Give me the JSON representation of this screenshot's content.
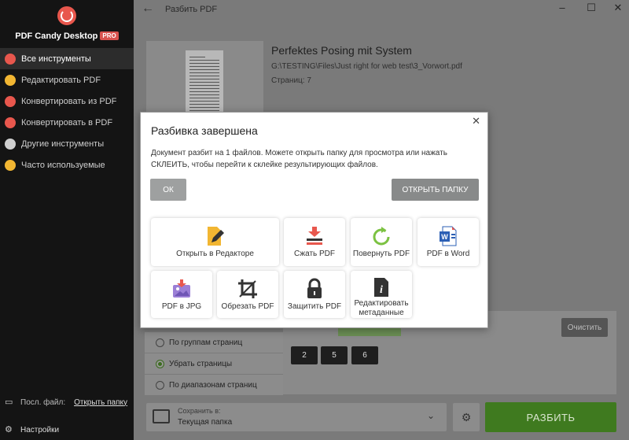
{
  "sidebar": {
    "brand": "PDF Candy Desktop",
    "pro_badge": "PRO",
    "items": [
      {
        "label": "Все инструменты",
        "icon": "candy-icon",
        "color": "#e8574d"
      },
      {
        "label": "Редактировать PDF",
        "icon": "edit-icon",
        "color": "#f2b632"
      },
      {
        "label": "Конвертировать из PDF",
        "icon": "download-icon",
        "color": "#e8574d"
      },
      {
        "label": "Конвертировать в PDF",
        "icon": "upload-icon",
        "color": "#e8574d"
      },
      {
        "label": "Другие инструменты",
        "icon": "more-icon",
        "color": "#cfcfcf"
      },
      {
        "label": "Часто используемые",
        "icon": "star-icon",
        "color": "#f2b632"
      }
    ],
    "last_file_label": "Посл. файл:",
    "open_folder_link": "Открыть папку",
    "settings_label": "Настройки"
  },
  "header": {
    "title": "Разбить PDF"
  },
  "document": {
    "title": "Perfektes Posing mit System",
    "path": "G:\\TESTING\\Files\\Just right for web test\\3_Vorwort.pdf",
    "pages": "Страниц: 7"
  },
  "options": {
    "items": [
      {
        "label": "По группам страниц",
        "selected": false
      },
      {
        "label": "Убрать страницы",
        "selected": true
      },
      {
        "label": "По диапазонам страниц",
        "selected": false
      }
    ],
    "clear_label": "Очистить",
    "page_numbers": [
      "2",
      "5",
      "6"
    ]
  },
  "footer": {
    "save_to_label": "Сохранить в:",
    "save_to_value": "Текущая папка",
    "split_button": "РАЗБИТЬ"
  },
  "modal": {
    "title": "Разбивка завершена",
    "message": "Документ разбит на 1 файлов. Можете открыть папку для просмотра или нажать СКЛЕИТЬ, чтобы перейти к склейке результирующих файлов.",
    "ok_label": "ОК",
    "open_folder_label": "ОТКРЫТЬ ПАПКУ",
    "tools": [
      {
        "label": "Открыть в Редакторе",
        "icon": "edit-icon"
      },
      {
        "label": "Сжать PDF",
        "icon": "compress-icon"
      },
      {
        "label": "Повернуть PDF",
        "icon": "rotate-icon"
      },
      {
        "label": "PDF в Word",
        "icon": "word-icon"
      },
      {
        "label": "PDF в JPG",
        "icon": "image-icon"
      },
      {
        "label": "Обрезать PDF",
        "icon": "crop-icon"
      },
      {
        "label": "Защитить PDF",
        "icon": "lock-icon"
      },
      {
        "label": "Редактировать метаданные",
        "icon": "info-icon"
      }
    ]
  },
  "colors": {
    "accent_green": "#3f7a1f",
    "brand_red": "#e8574d",
    "sidebar_bg": "#141414"
  }
}
